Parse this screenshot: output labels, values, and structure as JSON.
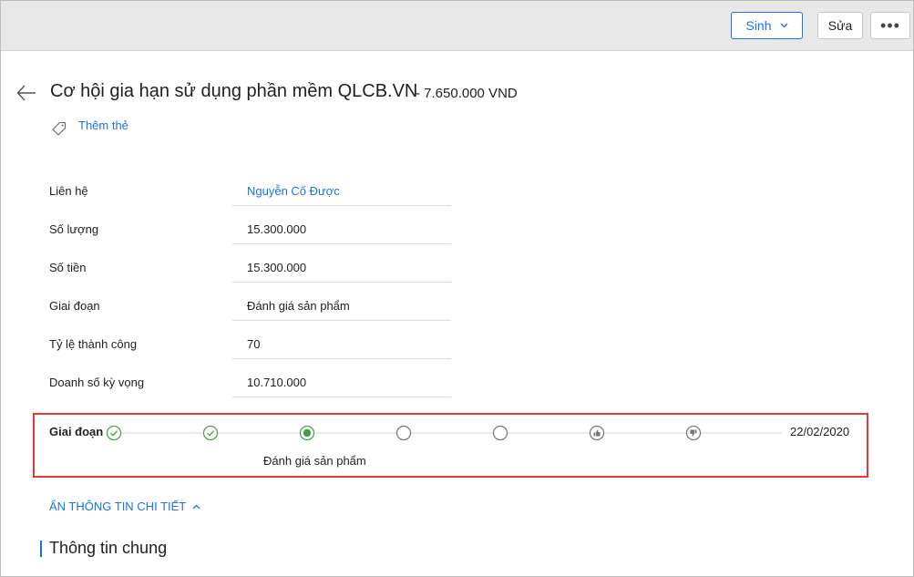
{
  "toolbar": {
    "generate_label": "Sinh",
    "edit_label": "Sửa",
    "more_label": "•••"
  },
  "header": {
    "title": "Cơ hội gia hạn sử dụng phần mềm QLCB.VN",
    "amount": "- 7.650.000 VND",
    "add_tag_label": "Thêm thẻ"
  },
  "fields": [
    {
      "label": "Liên hệ",
      "value": "Nguyễn Cố Được"
    },
    {
      "label": "Số lượng",
      "value": "15.300.000"
    },
    {
      "label": "Số tiền",
      "value": "15.300.000"
    },
    {
      "label": "Giai đoạn",
      "value": "Đánh giá sản phẩm"
    },
    {
      "label": "Tỷ lệ thành công",
      "value": "70"
    },
    {
      "label": "Doanh số kỳ vọng",
      "value": "10.710.000"
    }
  ],
  "stage_tracker": {
    "label": "Giai đoạn",
    "date": "22/02/2020",
    "current_stage_label": "Đánh giá sản phẩm",
    "steps": [
      "done",
      "done",
      "current",
      "pending",
      "pending",
      "won",
      "lost"
    ],
    "colors": {
      "done": "#43a047",
      "pending": "#757575",
      "line": "#d6d6d6"
    }
  },
  "details_toggle_label": "ẨN THÔNG TIN CHI TIẾT",
  "section_title": "Thông tin chung"
}
